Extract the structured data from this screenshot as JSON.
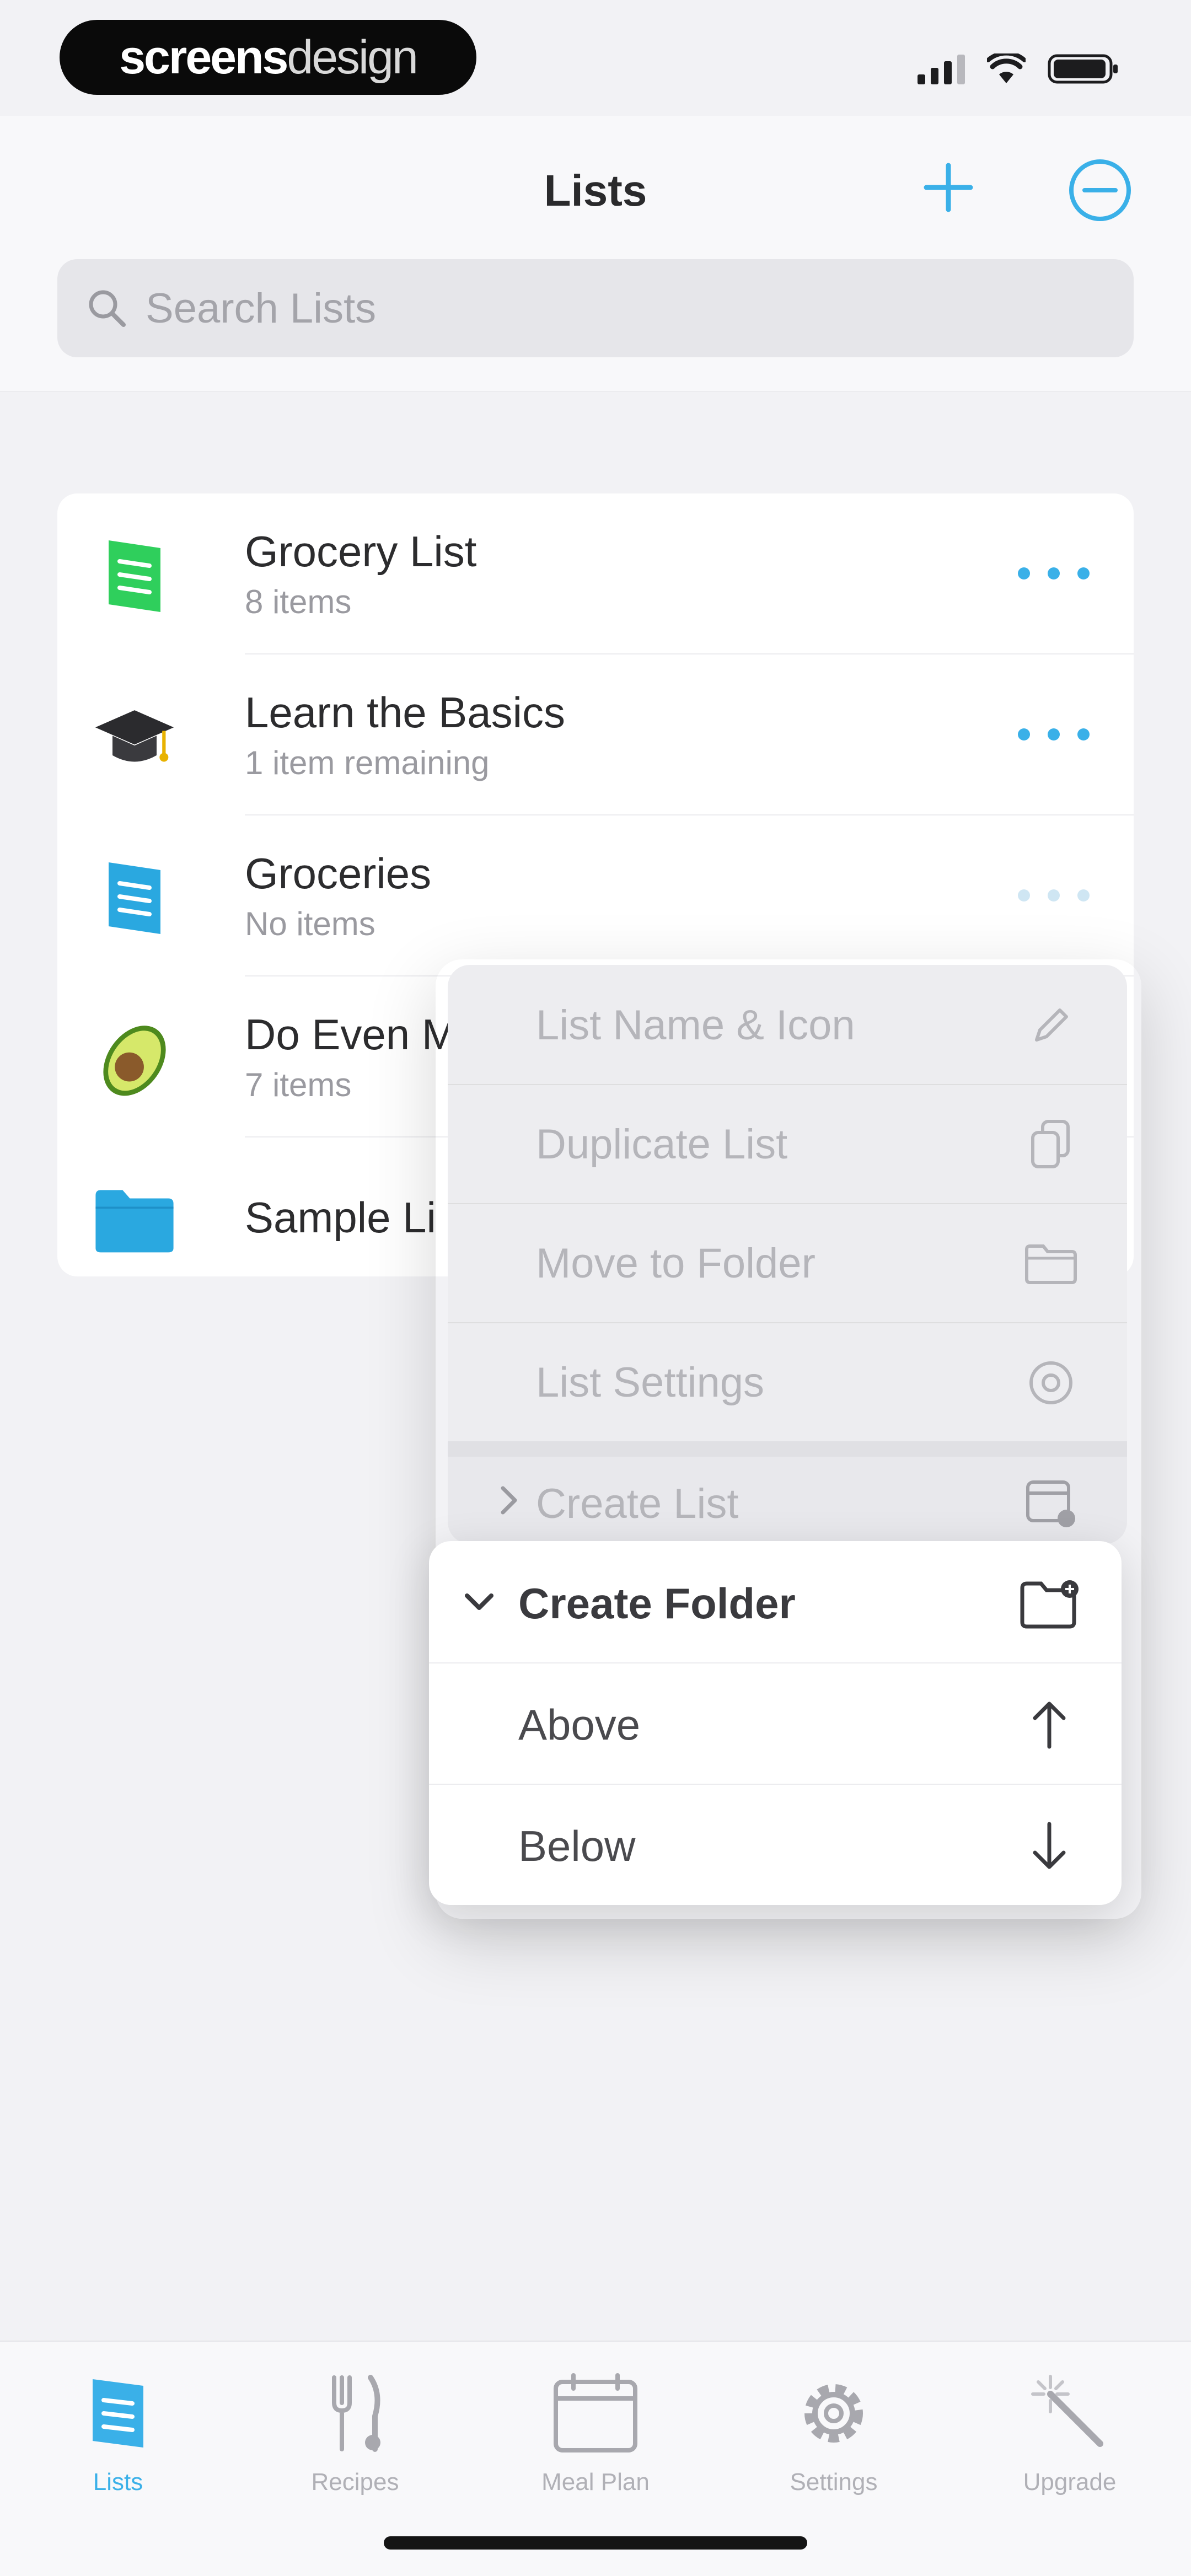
{
  "brand": {
    "bold": "screens",
    "thin": "design"
  },
  "status_bar": {
    "signal_icon": "cellular-signal-icon",
    "wifi_icon": "wifi-icon",
    "battery_icon": "battery-icon"
  },
  "header": {
    "title": "Lists",
    "add_icon": "plus-icon",
    "edit_icon": "minus-circle-icon",
    "search": {
      "placeholder": "Search Lists",
      "value": ""
    }
  },
  "lists": [
    {
      "title": "Grocery List",
      "subtitle": "8 items",
      "icon": "green-list-icon"
    },
    {
      "title": "Learn the Basics",
      "subtitle": "1 item remaining",
      "icon": "graduation-cap-icon"
    },
    {
      "title": "Groceries",
      "subtitle": "No items",
      "icon": "blue-list-icon"
    },
    {
      "title": "Do Even M",
      "subtitle": "7 items",
      "icon": "avocado-icon"
    },
    {
      "title": "Sample Li",
      "subtitle": "",
      "icon": "folder-icon"
    }
  ],
  "context_menu": {
    "items": [
      {
        "label": "List Name & Icon",
        "icon": "pencil-icon"
      },
      {
        "label": "Duplicate List",
        "icon": "duplicate-icon"
      },
      {
        "label": "Move to Folder",
        "icon": "folder-outline-icon"
      },
      {
        "label": "List Settings",
        "icon": "gear-icon"
      }
    ],
    "create_list": {
      "label": "Create List",
      "icon": "calendar-add-icon"
    },
    "create_folder": {
      "label": "Create Folder",
      "icon": "folder-add-icon",
      "options": [
        {
          "label": "Above",
          "icon": "arrow-up-icon"
        },
        {
          "label": "Below",
          "icon": "arrow-down-icon"
        }
      ]
    }
  },
  "tabs": [
    {
      "label": "Lists",
      "icon": "list-icon",
      "active": true
    },
    {
      "label": "Recipes",
      "icon": "fork-knife-icon",
      "active": false
    },
    {
      "label": "Meal Plan",
      "icon": "calendar-icon",
      "active": false
    },
    {
      "label": "Settings",
      "icon": "gear-icon",
      "active": false
    },
    {
      "label": "Upgrade",
      "icon": "magic-wand-icon",
      "active": false
    }
  ],
  "colors": {
    "accent": "#3ab0e8",
    "green": "#2fcf5c",
    "folder_blue": "#2aa8e0"
  }
}
